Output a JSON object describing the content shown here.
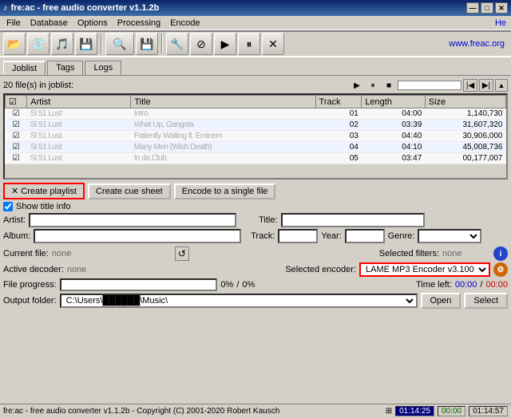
{
  "titleBar": {
    "icon": "♪",
    "title": "fre:ac - free audio converter v1.1.2b",
    "controls": [
      "—",
      "□",
      "✕"
    ]
  },
  "menuBar": {
    "items": [
      "File",
      "Database",
      "Options",
      "Processing",
      "Encode"
    ],
    "right": "He"
  },
  "website": "www.freac.org",
  "toolbar": {
    "buttons": [
      "folder-open",
      "cd-icon",
      "music-note",
      "folder-save",
      "magnify",
      "disk",
      "wrench",
      "stop-circle",
      "play-circle",
      "pause-circle",
      "stop-cross"
    ]
  },
  "tabs": {
    "items": [
      "Joblist",
      "Tags",
      "Logs"
    ],
    "active": 0
  },
  "joblist": {
    "info": "20 file(s) in joblist:",
    "columns": [
      "",
      "Artist",
      "Title",
      "Track",
      "Length",
      "Size"
    ],
    "rows": [
      {
        "check": "☑",
        "artist": "Sl 51 Lust",
        "title": "Intro",
        "track": "01",
        "length": "04:00",
        "size": "1,140,730"
      },
      {
        "check": "☑",
        "artist": "Sl 51 Lust",
        "title": "What Up, Gangsta",
        "track": "02",
        "length": "03:39",
        "size": "31,607,320"
      },
      {
        "check": "☑",
        "artist": "Sl 51 Lust",
        "title": "Patiently Waiting ft. Eminem",
        "track": "03",
        "length": "04:40",
        "size": "30,906,000"
      },
      {
        "check": "☑",
        "artist": "Sl 51 Lust",
        "title": "Many Men (Wish Death)",
        "track": "04",
        "length": "04:10",
        "size": "45,008,736"
      },
      {
        "check": "☑",
        "artist": "Sl 51 Lust",
        "title": "In da Club",
        "track": "05",
        "length": "03:47",
        "size": "00,177,007"
      }
    ]
  },
  "actionButtons": {
    "createPlaylist": "✕  Create playlist",
    "createCueSheet": "Create cue sheet",
    "encodeToSingle": "Encode to a single file",
    "showTitleInfo": "Show title info"
  },
  "infoFields": {
    "artistLabel": "Artist:",
    "titleLabel": "Title:",
    "albumLabel": "Album:",
    "trackLabel": "Track:",
    "yearLabel": "Year:",
    "genreLabel": "Genre:"
  },
  "fileInfo": {
    "currentFileLabel": "Current file:",
    "currentFileValue": "none",
    "selectedFiltersLabel": "Selected filters:",
    "selectedFiltersValue": "none",
    "activeDecoderLabel": "Active decoder:",
    "activeDecoderValue": "none",
    "selectedEncoderLabel": "Selected encoder:",
    "selectedEncoderValue": "LAME MP3 Encoder v3.100"
  },
  "progress": {
    "fileProgressLabel": "File progress:",
    "percent1": "0%",
    "percent2": "0%",
    "timeLeftLabel": "Time left:",
    "time1": "00:00",
    "time2": "00:00"
  },
  "output": {
    "label": "Output folder:",
    "path": "C:\\Users\\██████\\Music\\",
    "openBtn": "Open",
    "selectBtn": "Select"
  },
  "statusBar": {
    "copyright": "fre:ac - free audio converter v1.1.2b - Copyright (C) 2001-2020 Robert Kausch",
    "icon1": "⊞",
    "time": "01:14:25",
    "elapsed": "00:00",
    "remaining": "01:14:57"
  }
}
